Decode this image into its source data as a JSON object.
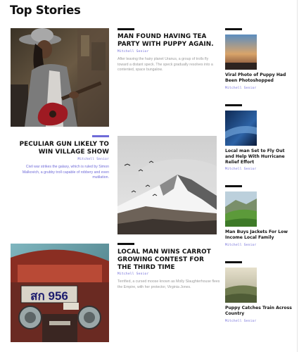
{
  "page": {
    "title": "Top Stories"
  },
  "main_stories": [
    {
      "headline": "MAN FOUND HAVING TEA PARTY WITH PUPPY AGAIN.",
      "author": "Mitchell Senior",
      "excerpt": "After leaving the hairy planet Uranus, a group of trolls fly toward a distant speck. The speck gradually resolves into a contented, space bungalow.",
      "image": "woman-playing-guitar-photo"
    },
    {
      "headline": "PECULIAR GUN LIKELY TO WIN VILLAGE SHOW",
      "author": "Mitchell Senior",
      "excerpt": "Civil war strikes the galaxy, which is ruled by Simon Malkovich, a grubby troll capable of robbery and even mutilation.",
      "image": "snowy-mountain-birds-photo"
    },
    {
      "headline": "LOCAL MAN WINS CARROT GROWING CONTEST FOR THE THIRD TIME",
      "author": "Mitchell Senior",
      "excerpt": "Terrified, a cursed moose known as Molly Slaughterhouse flees the Empire, with her protector, Virginia Jones.",
      "image": "red-tuk-tuk-license-plate-photo"
    }
  ],
  "side_stories": [
    {
      "title": "Viral Photo of Puppy Had Been Photoshopped",
      "author": "Mitchell Senior",
      "image": "sunset-sky-photo"
    },
    {
      "title": "Local man Set to Fly Out and Help With Hurricane Relief Effort",
      "author": "Mitchell Senior",
      "image": "blue-ocean-wave-photo"
    },
    {
      "title": "Man Buys Jackets For Low Income Local Family",
      "author": "Mitchell Senior",
      "image": "green-hills-photo"
    },
    {
      "title": "Puppy Catches Train Across Country",
      "author": "Mitchell Senior",
      "image": "misty-valley-photo"
    }
  ],
  "plate_text": "สก 956",
  "colors": {
    "accent": "#6f6bd8",
    "text": "#111111",
    "muted": "#9a9a9a"
  }
}
